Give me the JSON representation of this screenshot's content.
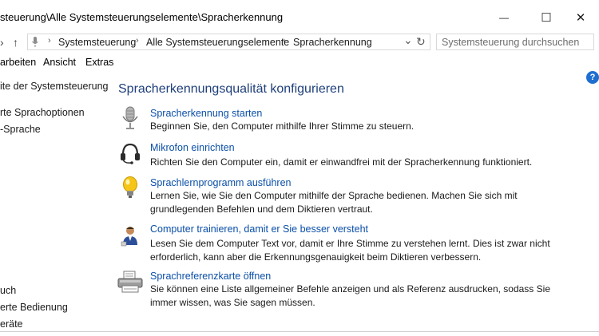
{
  "window": {
    "title": "steuerung\\Alle Systemsteuerungselemente\\Spracherkennung",
    "minimize_glyph": "—",
    "maximize_glyph": "☐",
    "close_glyph": "✕"
  },
  "address": {
    "back_glyph": "›",
    "up_glyph": "↑",
    "crumbs": [
      "Systemsteuerung",
      "Alle Systemsteuerungselemente",
      "Spracherkennung"
    ],
    "separator": "›",
    "dropdown_glyph": "⌄",
    "refresh_glyph": "↻"
  },
  "search": {
    "placeholder": "Systemsteuerung durchsuchen"
  },
  "menu": {
    "items": [
      "arbeiten",
      "Ansicht",
      "Extras"
    ]
  },
  "left_pane": {
    "links": [
      "ite der Systemsteuerung",
      "rte Sprachoptionen",
      "-Sprache"
    ],
    "bottom_links": [
      "uch",
      "erte Bedienung",
      "eräte"
    ]
  },
  "main": {
    "heading": "Spracherkennungsqualität konfigurieren",
    "tasks": [
      {
        "icon": "microphone-icon",
        "link": "Spracherkennung starten",
        "desc": "Beginnen Sie, den Computer mithilfe Ihrer Stimme zu steuern."
      },
      {
        "icon": "headset-icon",
        "link": "Mikrofon einrichten",
        "desc": "Richten Sie den Computer ein, damit er einwandfrei mit der Spracherkennung funktioniert."
      },
      {
        "icon": "lightbulb-icon",
        "link": "Sprachlernprogramm ausführen",
        "desc": "Lernen Sie, wie Sie den Computer mithilfe der Sprache bedienen. Machen Sie sich mit grundlegenden Befehlen und dem Diktieren vertraut."
      },
      {
        "icon": "user-training-icon",
        "link": "Computer trainieren, damit er Sie besser versteht",
        "desc": "Lesen Sie dem Computer Text vor, damit er Ihre Stimme zu verstehen lernt. Dies ist zwar nicht erforderlich, kann aber die Erkennungsgenauigkeit beim Diktieren verbessern."
      },
      {
        "icon": "printer-icon",
        "link": "Sprachreferenzkarte öffnen",
        "desc": "Sie können eine Liste allgemeiner Befehle anzeigen und als Referenz ausdrucken, sodass Sie immer wissen, was Sie sagen müssen."
      }
    ]
  },
  "help": {
    "glyph": "?"
  },
  "colors": {
    "link": "#0b4fa8",
    "heading": "#1e3f7a",
    "help": "#1f6fd0"
  }
}
